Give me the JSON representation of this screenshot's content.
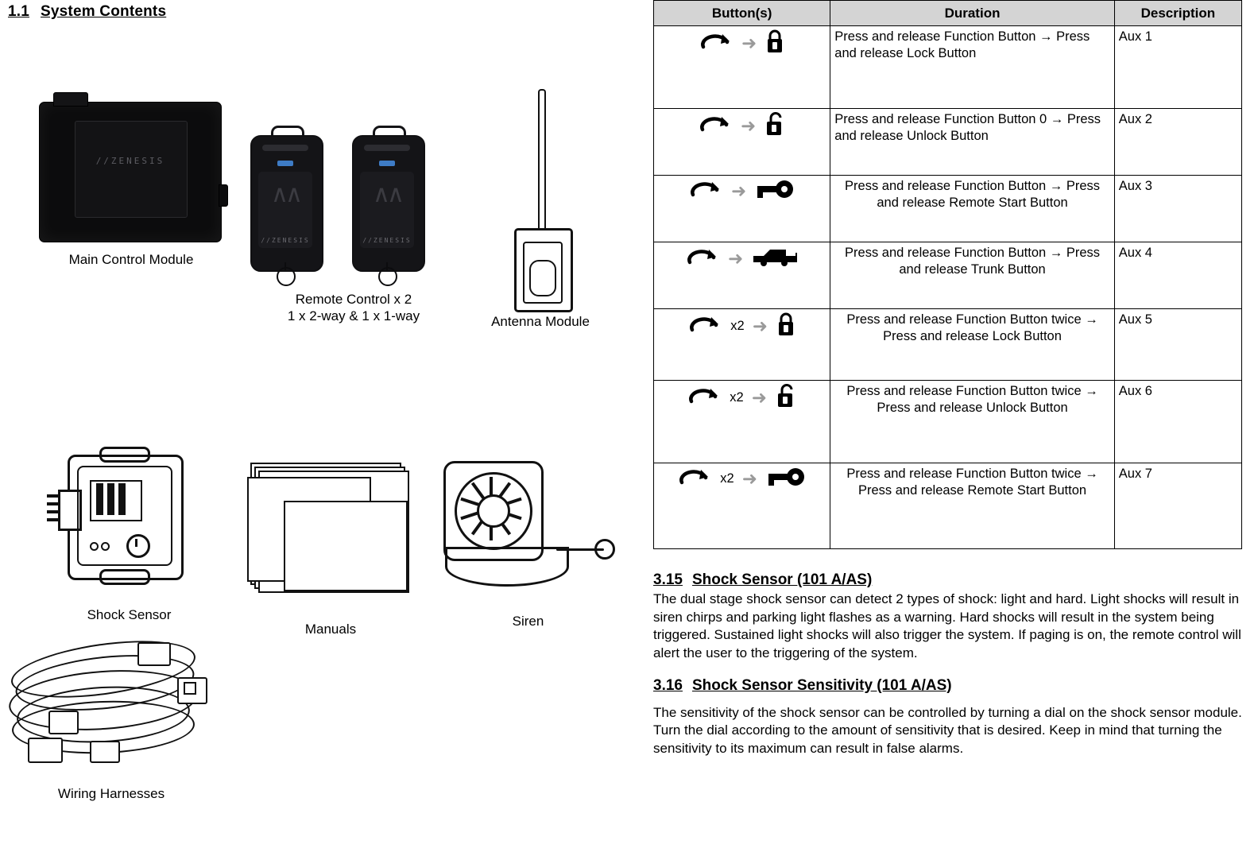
{
  "left": {
    "section_number": "1.1",
    "section_title": "System Contents",
    "items": [
      {
        "id": "main-control-module",
        "caption": "Main Control Module"
      },
      {
        "id": "remote-control",
        "caption": "Remote Control x 2",
        "caption2": "1 x 2-way & 1 x 1-way"
      },
      {
        "id": "antenna-module",
        "caption": "Antenna Module"
      },
      {
        "id": "shock-sensor",
        "caption": "Shock Sensor"
      },
      {
        "id": "manuals",
        "caption": "Manuals"
      },
      {
        "id": "siren",
        "caption": "Siren"
      },
      {
        "id": "wiring-harnesses",
        "caption": "Wiring Harnesses"
      }
    ],
    "module_brand": "//ZENESIS",
    "remote_brand": "//ZENESIS"
  },
  "table": {
    "headers": [
      "Button(s)",
      "Duration",
      "Description"
    ],
    "rows": [
      {
        "icon_left": "function-button-icon",
        "icon_multiplier": "",
        "icon_right": "lock-closed-icon",
        "duration": "Press and release Function Button → Press and release Lock Button",
        "duration_align": "left",
        "description": "Aux 1"
      },
      {
        "icon_left": "function-button-icon",
        "icon_multiplier": "",
        "icon_right": "lock-open-icon",
        "duration": "Press and release Function Button 0 → Press and release Unlock Button",
        "duration_align": "left",
        "description": "Aux 2"
      },
      {
        "icon_left": "function-button-icon",
        "icon_multiplier": "",
        "icon_right": "key-icon",
        "duration": "Press and release Function Button → Press and release  Remote Start Button",
        "duration_align": "center",
        "description": "Aux 3"
      },
      {
        "icon_left": "function-button-icon",
        "icon_multiplier": "",
        "icon_right": "trunk-car-icon",
        "duration": "Press and release Function Button → Press and release Trunk Button",
        "duration_align": "center",
        "description": "Aux 4"
      },
      {
        "icon_left": "function-button-icon",
        "icon_multiplier": "x2",
        "icon_right": "lock-closed-icon",
        "duration": "Press and release Function Button twice → Press and release Lock Button",
        "duration_align": "center",
        "description": "Aux 5"
      },
      {
        "icon_left": "function-button-icon",
        "icon_multiplier": "x2",
        "icon_right": "lock-open-icon",
        "duration": "Press and release Function Button twice → Press and release Unlock Button",
        "duration_align": "center",
        "description": "Aux 6"
      },
      {
        "icon_left": "function-button-icon",
        "icon_multiplier": "x2",
        "icon_right": "key-icon",
        "duration": "Press and release Function Button twice → Press and release Remote Start Button",
        "duration_align": "center",
        "description": "Aux 7"
      }
    ]
  },
  "sections": [
    {
      "number": "3.15",
      "title": "Shock Sensor (101 A/AS)",
      "body": "The dual stage shock sensor can detect 2 types of shock: light and hard.  Light shocks will result in siren chirps and parking light flashes as a warning.  Hard shocks will result in the system being triggered.  Sustained light shocks will also trigger the system.  If paging is on, the remote control will alert the user to the triggering of the system."
    },
    {
      "number": "3.16",
      "title": "Shock Sensor Sensitivity (101 A/AS)",
      "body": "The sensitivity of the shock sensor can be controlled by turning a dial on the shock sensor module.  Turn the dial according to the amount of sensitivity that is desired.  Keep in mind that turning the sensitivity to its maximum can result in false alarms."
    }
  ]
}
